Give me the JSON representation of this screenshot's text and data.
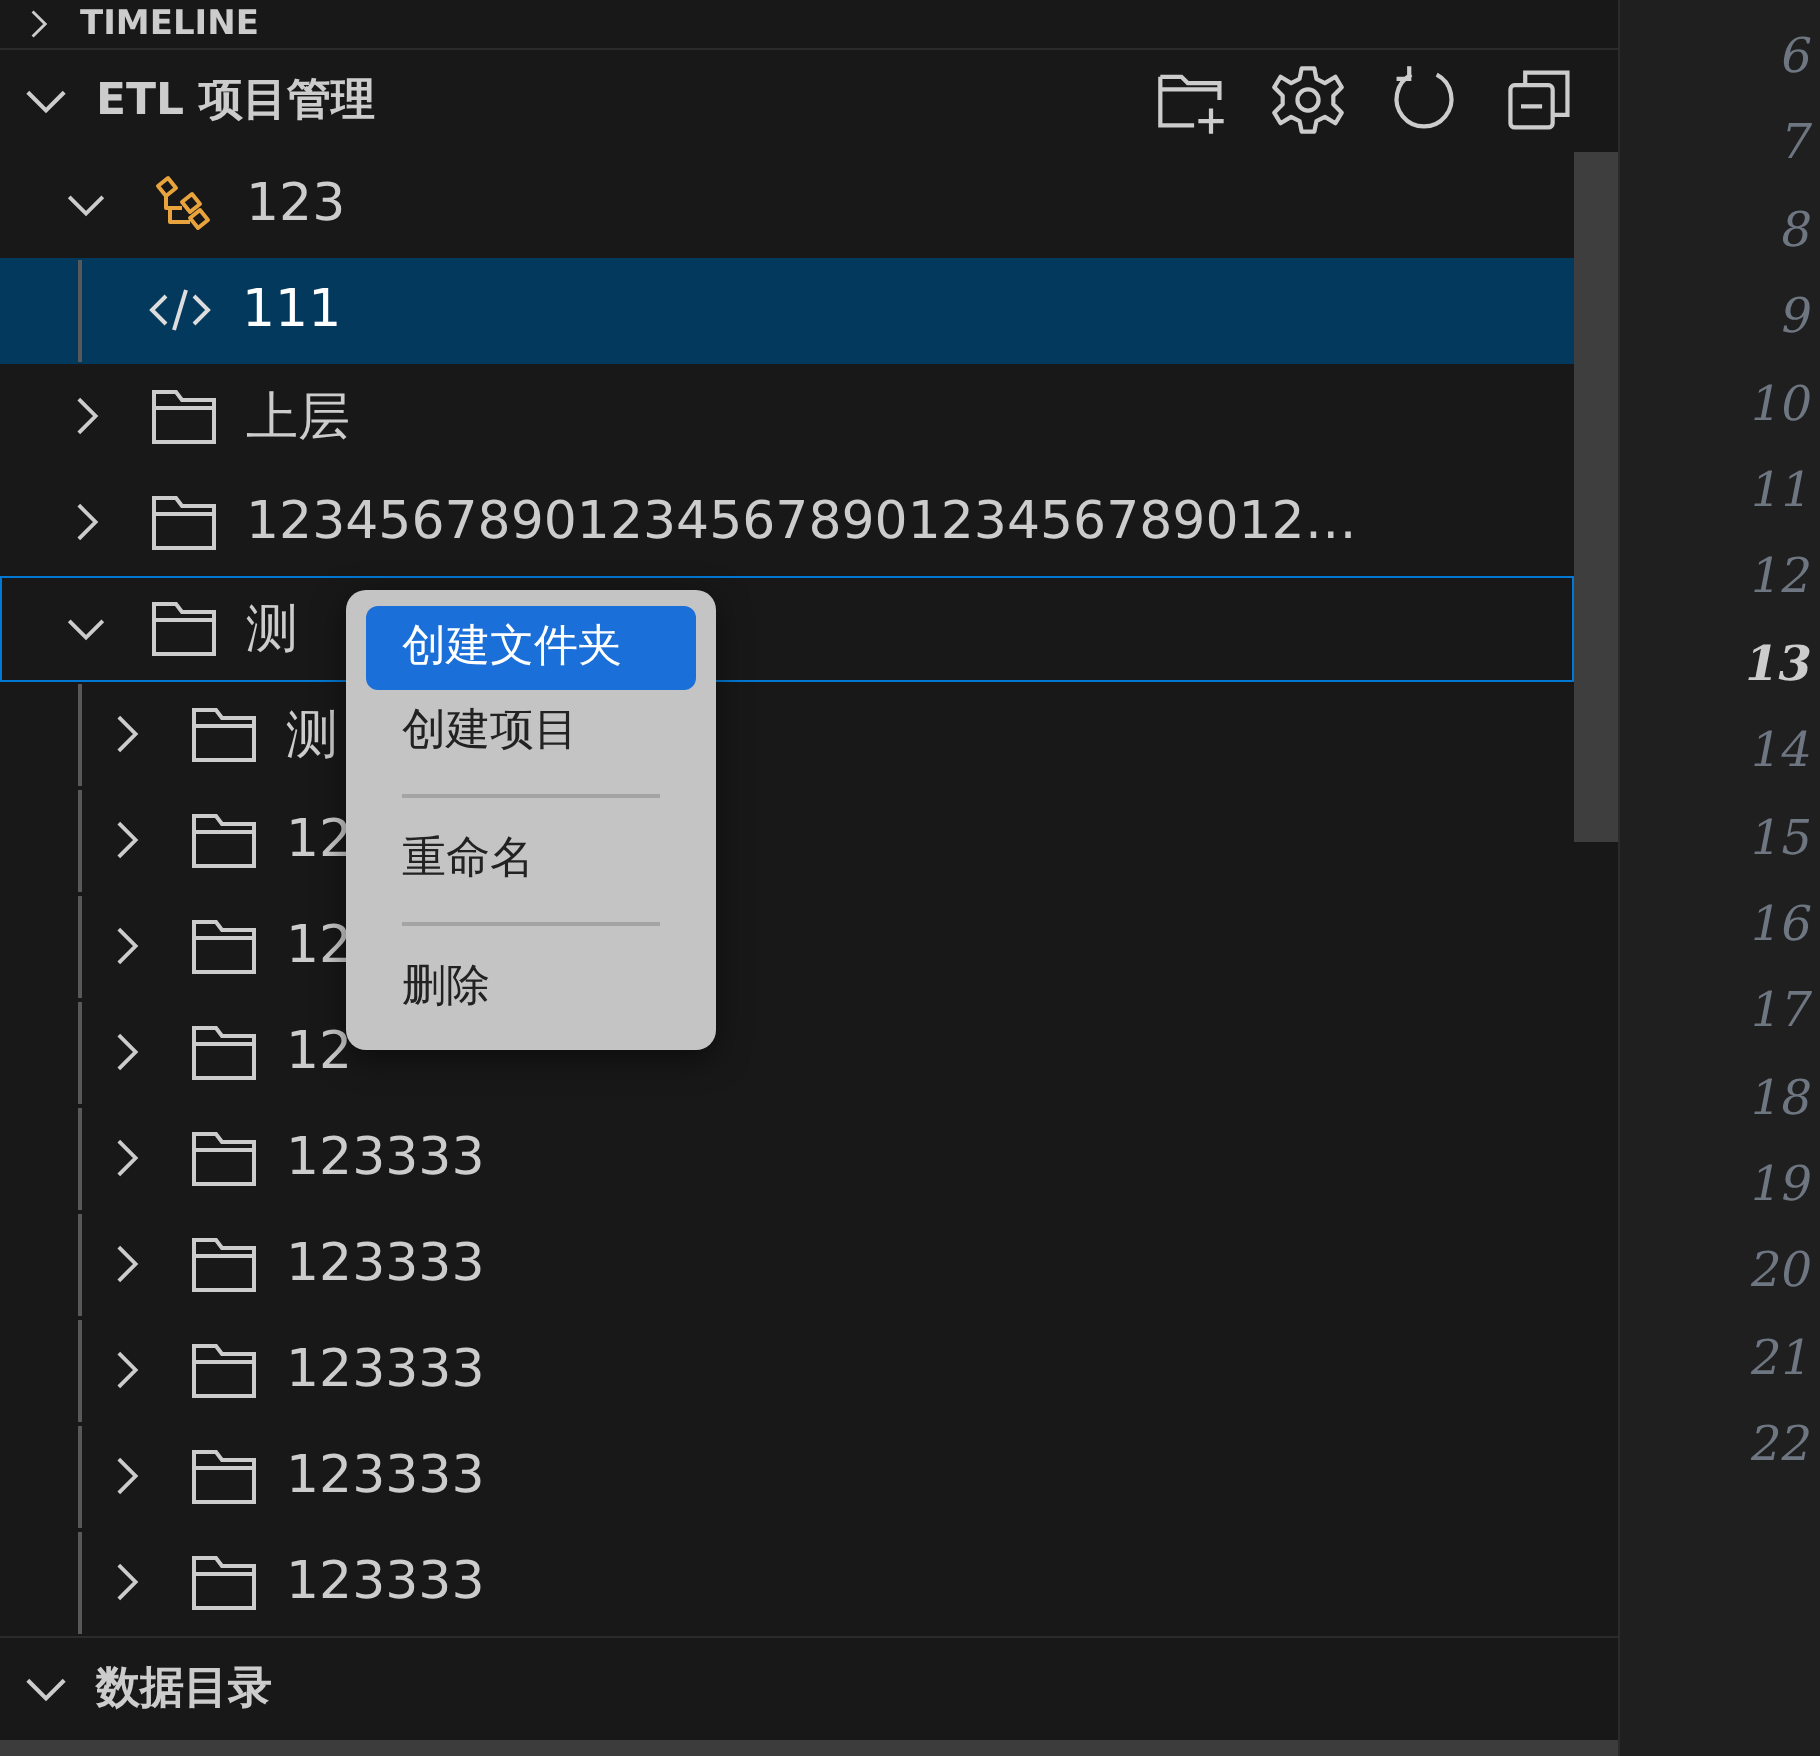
{
  "sections": [
    {
      "title": "TIMELINE",
      "expanded": false
    },
    {
      "title": "ETL 项目管理",
      "expanded": true,
      "toolbar": true,
      "tree": [
        {
          "label": "123",
          "kind": "project",
          "expanded": true,
          "selected": false,
          "focused": false,
          "children": [
            {
              "label": "111",
              "kind": "code",
              "selected": true,
              "focused": false
            }
          ]
        },
        {
          "label": "上层",
          "kind": "folder",
          "expanded": false,
          "selected": false,
          "focused": false
        },
        {
          "label": "12345678901234567890123456789012…",
          "kind": "folder",
          "expanded": false,
          "selected": false,
          "focused": false
        },
        {
          "label": "测",
          "kind": "folder",
          "expanded": true,
          "selected": false,
          "focused": true,
          "children": [
            {
              "label": "测",
              "kind": "folder",
              "expanded": false,
              "selected": false,
              "focused": false
            },
            {
              "label": "12",
              "kind": "folder",
              "expanded": false,
              "selected": false,
              "focused": false
            },
            {
              "label": "12",
              "kind": "folder",
              "expanded": false,
              "selected": false,
              "focused": false
            },
            {
              "label": "12",
              "kind": "folder",
              "expanded": false,
              "selected": false,
              "focused": false
            },
            {
              "label": "123333",
              "kind": "folder",
              "expanded": false,
              "selected": false,
              "focused": false
            },
            {
              "label": "123333",
              "kind": "folder",
              "expanded": false,
              "selected": false,
              "focused": false
            },
            {
              "label": "123333",
              "kind": "folder",
              "expanded": false,
              "selected": false,
              "focused": false
            },
            {
              "label": "123333",
              "kind": "folder",
              "expanded": false,
              "selected": false,
              "focused": false
            },
            {
              "label": "123333",
              "kind": "folder",
              "expanded": false,
              "selected": false,
              "focused": false
            }
          ]
        }
      ]
    },
    {
      "title": "数据目录",
      "expanded": true
    }
  ],
  "context_menu": {
    "items": [
      {
        "kind": "item",
        "label": "创建文件夹",
        "selected": true
      },
      {
        "kind": "item",
        "label": "创建项目",
        "selected": false
      },
      {
        "kind": "separator"
      },
      {
        "kind": "item",
        "label": "重命名",
        "selected": false
      },
      {
        "kind": "separator"
      },
      {
        "kind": "item",
        "label": "删除",
        "selected": false
      }
    ]
  },
  "line_numbers": [
    {
      "number": "6",
      "current": false
    },
    {
      "number": "7",
      "current": false
    },
    {
      "number": "8",
      "current": false
    },
    {
      "number": "9",
      "current": false
    },
    {
      "number": "10",
      "current": false
    },
    {
      "number": "11",
      "current": false
    },
    {
      "number": "12",
      "current": false
    },
    {
      "number": "13",
      "current": true
    },
    {
      "number": "14",
      "current": false
    },
    {
      "number": "15",
      "current": false
    },
    {
      "number": "16",
      "current": false
    },
    {
      "number": "17",
      "current": false
    },
    {
      "number": "18",
      "current": false
    },
    {
      "number": "19",
      "current": false
    },
    {
      "number": "20",
      "current": false
    },
    {
      "number": "21",
      "current": false
    },
    {
      "number": "22",
      "current": false
    }
  ]
}
